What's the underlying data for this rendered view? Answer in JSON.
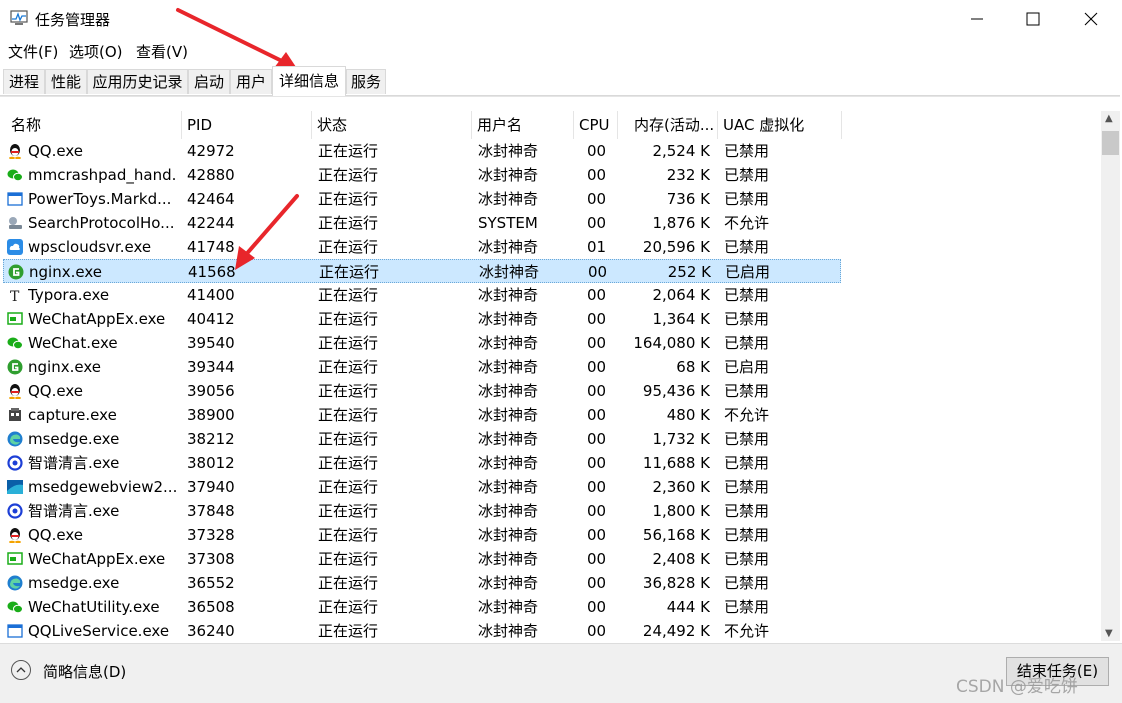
{
  "window": {
    "title": "任务管理器"
  },
  "menu": [
    "文件(F)",
    "选项(O)",
    "查看(V)"
  ],
  "tabs": [
    "进程",
    "性能",
    "应用历史记录",
    "启动",
    "用户",
    "详细信息",
    "服务"
  ],
  "active_tab": "详细信息",
  "columns": {
    "name": "名称",
    "pid": "PID",
    "status": "状态",
    "user": "用户名",
    "cpu": "CPU",
    "mem": "内存(活动...",
    "uac": "UAC 虚拟化"
  },
  "rows": [
    {
      "name": "QQ.exe",
      "pid": "42972",
      "status": "正在运行",
      "user": "冰封神奇",
      "cpu": "00",
      "mem": "2,524 K",
      "uac": "已禁用",
      "icon": "qq-icon"
    },
    {
      "name": "mmcrashpad_hand...",
      "pid": "42880",
      "status": "正在运行",
      "user": "冰封神奇",
      "cpu": "00",
      "mem": "232 K",
      "uac": "已禁用",
      "icon": "wechat-icon"
    },
    {
      "name": "PowerToys.Markd...",
      "pid": "42464",
      "status": "正在运行",
      "user": "冰封神奇",
      "cpu": "00",
      "mem": "736 K",
      "uac": "已禁用",
      "icon": "window-icon"
    },
    {
      "name": "SearchProtocolHo...",
      "pid": "42244",
      "status": "正在运行",
      "user": "SYSTEM",
      "cpu": "00",
      "mem": "1,876 K",
      "uac": "不允许",
      "icon": "search-service-icon"
    },
    {
      "name": "wpscloudsvr.exe",
      "pid": "41748",
      "status": "正在运行",
      "user": "冰封神奇",
      "cpu": "01",
      "mem": "20,596 K",
      "uac": "已禁用",
      "icon": "cloud-icon"
    },
    {
      "name": "nginx.exe",
      "pid": "41568",
      "status": "正在运行",
      "user": "冰封神奇",
      "cpu": "00",
      "mem": "252 K",
      "uac": "已启用",
      "icon": "nginx-icon",
      "selected": true
    },
    {
      "name": "Typora.exe",
      "pid": "41400",
      "status": "正在运行",
      "user": "冰封神奇",
      "cpu": "00",
      "mem": "2,064 K",
      "uac": "已禁用",
      "icon": "typora-icon"
    },
    {
      "name": "WeChatAppEx.exe",
      "pid": "40412",
      "status": "正在运行",
      "user": "冰封神奇",
      "cpu": "00",
      "mem": "1,364 K",
      "uac": "已禁用",
      "icon": "wechat-app-icon"
    },
    {
      "name": "WeChat.exe",
      "pid": "39540",
      "status": "正在运行",
      "user": "冰封神奇",
      "cpu": "00",
      "mem": "164,080 K",
      "uac": "已禁用",
      "icon": "wechat-icon"
    },
    {
      "name": "nginx.exe",
      "pid": "39344",
      "status": "正在运行",
      "user": "冰封神奇",
      "cpu": "00",
      "mem": "68 K",
      "uac": "已启用",
      "icon": "nginx-icon"
    },
    {
      "name": "QQ.exe",
      "pid": "39056",
      "status": "正在运行",
      "user": "冰封神奇",
      "cpu": "00",
      "mem": "95,436 K",
      "uac": "已禁用",
      "icon": "qq-icon"
    },
    {
      "name": "capture.exe",
      "pid": "38900",
      "status": "正在运行",
      "user": "冰封神奇",
      "cpu": "00",
      "mem": "480 K",
      "uac": "不允许",
      "icon": "capture-icon"
    },
    {
      "name": "msedge.exe",
      "pid": "38212",
      "status": "正在运行",
      "user": "冰封神奇",
      "cpu": "00",
      "mem": "1,732 K",
      "uac": "已禁用",
      "icon": "edge-icon"
    },
    {
      "name": "智谱清言.exe",
      "pid": "38012",
      "status": "正在运行",
      "user": "冰封神奇",
      "cpu": "00",
      "mem": "11,688 K",
      "uac": "已禁用",
      "icon": "zhipu-icon"
    },
    {
      "name": "msedgewebview2....",
      "pid": "37940",
      "status": "正在运行",
      "user": "冰封神奇",
      "cpu": "00",
      "mem": "2,360 K",
      "uac": "已禁用",
      "icon": "webview-icon"
    },
    {
      "name": "智谱清言.exe",
      "pid": "37848",
      "status": "正在运行",
      "user": "冰封神奇",
      "cpu": "00",
      "mem": "1,800 K",
      "uac": "已禁用",
      "icon": "zhipu-icon"
    },
    {
      "name": "QQ.exe",
      "pid": "37328",
      "status": "正在运行",
      "user": "冰封神奇",
      "cpu": "00",
      "mem": "56,168 K",
      "uac": "已禁用",
      "icon": "qq-icon"
    },
    {
      "name": "WeChatAppEx.exe",
      "pid": "37308",
      "status": "正在运行",
      "user": "冰封神奇",
      "cpu": "00",
      "mem": "2,408 K",
      "uac": "已禁用",
      "icon": "wechat-app-icon"
    },
    {
      "name": "msedge.exe",
      "pid": "36552",
      "status": "正在运行",
      "user": "冰封神奇",
      "cpu": "00",
      "mem": "36,828 K",
      "uac": "已禁用",
      "icon": "edge-icon"
    },
    {
      "name": "WeChatUtility.exe",
      "pid": "36508",
      "status": "正在运行",
      "user": "冰封神奇",
      "cpu": "00",
      "mem": "444 K",
      "uac": "已禁用",
      "icon": "wechat-icon"
    },
    {
      "name": "QQLiveService.exe",
      "pid": "36240",
      "status": "正在运行",
      "user": "冰封神奇",
      "cpu": "00",
      "mem": "24,492 K",
      "uac": "不允许",
      "icon": "window-icon"
    }
  ],
  "footer": {
    "fewer_details": "简略信息(D)",
    "end_task": "结束任务(E)"
  },
  "watermark": "CSDN @爱吃饼",
  "colors": {
    "selection": "#cce8ff",
    "arrow": "#e8262b",
    "accent_green": "#1aad19"
  }
}
